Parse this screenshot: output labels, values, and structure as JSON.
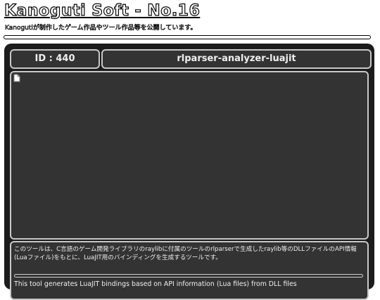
{
  "site": {
    "title": "Kanoguti Soft - No.16",
    "subtitle": "Kanogutiが制作したゲーム作品やツール作品等を公開しています。"
  },
  "work": {
    "id_label": "ID : 440",
    "name": "rlparser-analyzer-luajit",
    "image_status": "broken-image-icon",
    "description_ja": "このツールは、C言語のゲーム開発ライブラリのraylibに付属のツールのrlparserで生成したraylib等のDLLファイルのAPI情報(Luaファイル)をもとに、LuaJIT用のバインディングを生成するツールです。",
    "description_en": "This tool generates LuaJIT bindings based on API information (Lua files) from DLL files"
  },
  "colors": {
    "panel_bg": "#1c1c1c",
    "box_bg": "#333333",
    "box_border": "#c8c8c8",
    "text": "#f0f0f0"
  }
}
